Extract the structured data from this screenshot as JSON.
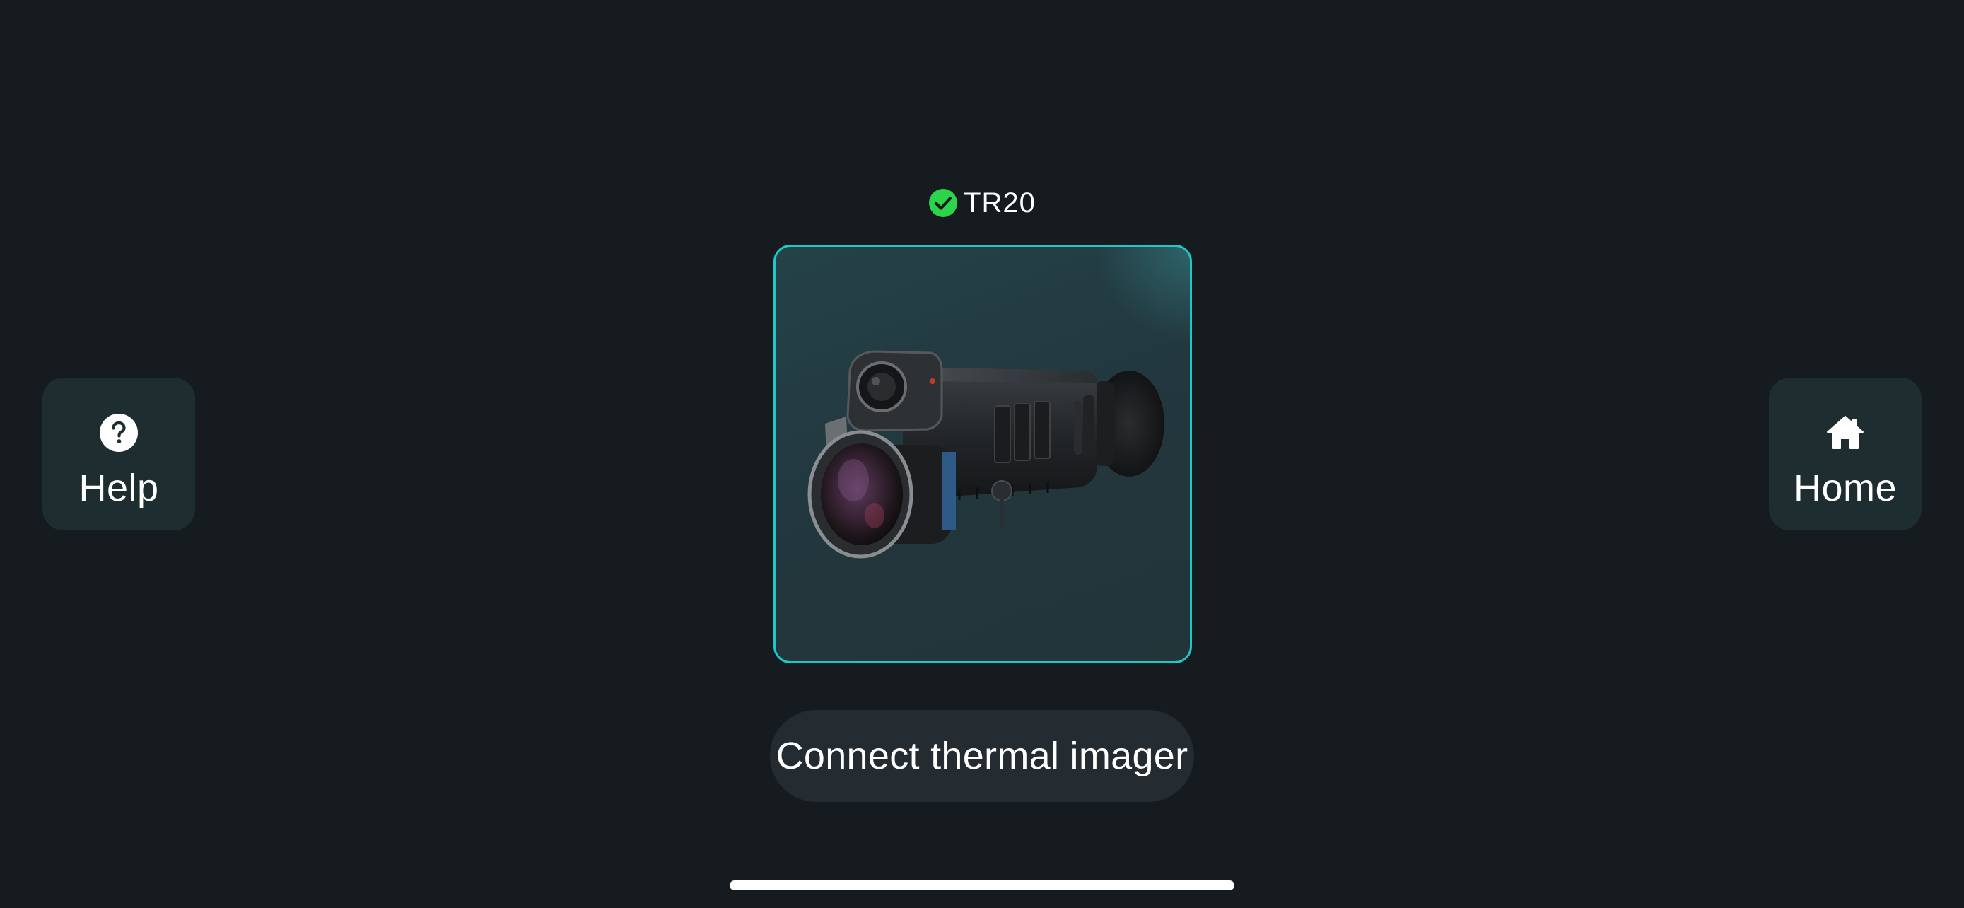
{
  "device": {
    "name": "TR20",
    "status": "connected",
    "status_color": "#2bd44a",
    "image_icon": "thermal-monocular-icon"
  },
  "sidebar_left": {
    "help_label": "Help",
    "help_icon": "question-icon"
  },
  "sidebar_right": {
    "home_label": "Home",
    "home_icon": "home-icon"
  },
  "actions": {
    "connect_label": "Connect thermal imager"
  },
  "colors": {
    "background": "#151b1f",
    "card_border": "#1fc7c6",
    "side_button": "#1e2e30",
    "connect_button": "#252c31"
  }
}
